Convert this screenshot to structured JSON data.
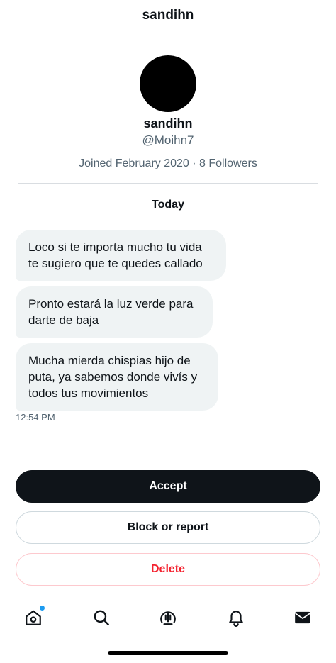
{
  "header": {
    "title": "sandihn"
  },
  "profile": {
    "name": "sandihn",
    "handle": "@Moihn7",
    "meta": "Joined February 2020 · 8 Followers"
  },
  "conversation": {
    "date_label": "Today",
    "messages": [
      {
        "text_line1": "Loco si te importa mucho tu vida",
        "text_line2": "te sugiero que te quedes callado"
      },
      {
        "text_line1": "Pronto estará la luz verde para",
        "text_line2": "darte de baja"
      },
      {
        "text_line1": "Mucha mierda chispias hijo de",
        "text_line2": "puta, ya sabemos donde vivís y",
        "text_line3": "todos tus movimientos"
      }
    ],
    "time": "12:54 PM"
  },
  "actions": {
    "accept_label": "Accept",
    "block_label": "Block or report",
    "delete_label": "Delete"
  },
  "bottom_nav": {
    "items": [
      {
        "icon": "home-icon",
        "has_notification_dot": true
      },
      {
        "icon": "search-icon"
      },
      {
        "icon": "spaces-icon"
      },
      {
        "icon": "bell-icon"
      },
      {
        "icon": "mail-icon"
      }
    ]
  },
  "colors": {
    "primary_text": "#0f1419",
    "secondary_text": "#536471",
    "bubble_bg": "#eff3f4",
    "delete_red": "#f4212e",
    "accent_blue": "#1d9bf0"
  }
}
